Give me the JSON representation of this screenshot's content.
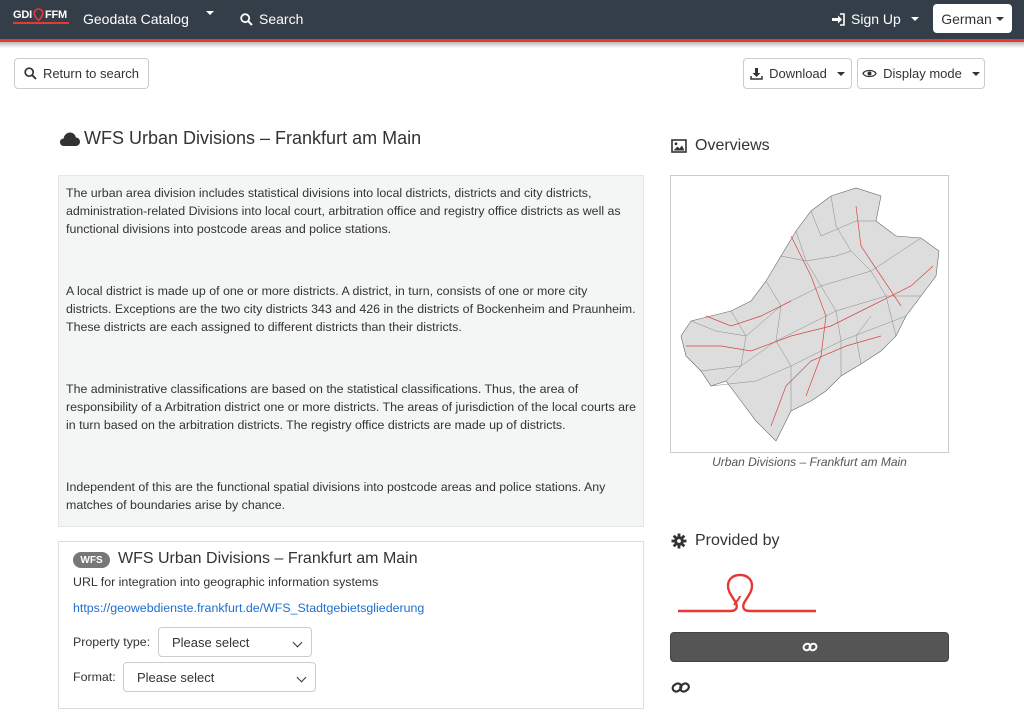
{
  "colors": {
    "navbar": "#343e48",
    "accent_red": "#e53935",
    "link_blue": "#1f6fd0",
    "badge_gray": "#777777"
  },
  "navbar": {
    "logo_left": "GDI",
    "logo_right": "FFM",
    "catalog": "Geodata Catalog",
    "search": "Search",
    "signup": "Sign Up",
    "language": "German"
  },
  "toolbar": {
    "return": "Return to search",
    "download": "Download",
    "display_mode": "Display mode"
  },
  "dataset": {
    "title": "WFS Urban Divisions – Frankfurt am Main",
    "description": [
      "The urban area division includes statistical divisions into local districts, districts and city districts, administration-related Divisions into local court, arbitration office and registry office districts as well as functional divisions into postcode areas and police stations.",
      "A local district is made up of one or more districts. A district, in turn, consists of one or more city districts. Exceptions are the two city districts 343 and 426 in the districts of Bockenheim and Praunheim. These districts are each assigned to different districts than their districts.",
      "The administrative classifications are based on the statistical classifications. Thus, the area of responsibility of a Arbitration district one or more districts. The areas of jurisdiction of the local courts are in turn based on the arbitration districts. The registry office districts are made up of districts.",
      "Independent of this are the functional spatial divisions into postcode areas and police stations. Any matches of boundaries arise by chance."
    ]
  },
  "service": {
    "badge": "WFS",
    "title": "WFS Urban Divisions – Frankfurt am Main",
    "subtitle": "URL for integration into geographic information systems",
    "url": "https://geowebdienste.frankfurt.de/WFS_Stadtgebietsgliederung",
    "property_label": "Property type:",
    "property_value": "Please select",
    "format_label": "Format:",
    "format_value": "Please select"
  },
  "sidebar": {
    "overviews_heading": "Overviews",
    "map_caption": "Urban Divisions – Frankfurt am Main",
    "provided_heading": "Provided by"
  },
  "icons": [
    "cloud-icon",
    "search-icon",
    "sign-in-icon",
    "download-icon",
    "eye-icon",
    "image-icon",
    "gear-icon",
    "link-icon"
  ]
}
